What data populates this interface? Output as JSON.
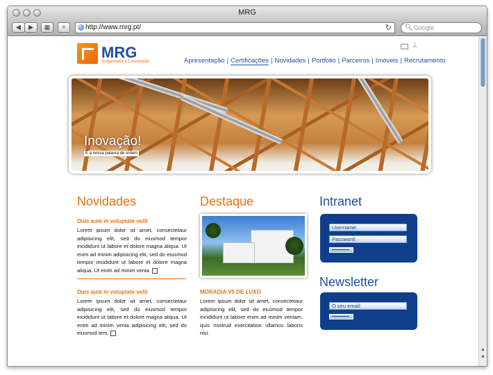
{
  "window": {
    "title": "MRG"
  },
  "toolbar": {
    "url": "http://www.mrg.pt/",
    "search_placeholder": "Google",
    "back_icon": "chevron-left-icon",
    "forward_icon": "chevron-right-icon"
  },
  "site": {
    "logo_name": "MRG",
    "logo_tagline": "Engenharia e Construção",
    "nav": [
      "Apresentação",
      "Certificações",
      "Novidades",
      "Portfolio",
      "Parceiros",
      "Imóveis",
      "Recrutamento"
    ],
    "active_nav": "Certificações",
    "colors": {
      "orange": "#e8720c",
      "blue": "#1e4f9c",
      "panel": "#0f3f8a"
    }
  },
  "banner": {
    "title": "Inovação!",
    "subtitle": "É a nossa palavra de ordem"
  },
  "novidades": {
    "heading": "Novidades",
    "items": [
      {
        "title": "Duis aute in voluptate velit",
        "text": "Lorem ipsum dolor sit amet, consectetaur adipisicing elit, sed do eiusmod tempor incididunt ut labore et dolore magna aliqua. Ut enim ad minim adipisicing elit, sed do eiusmod tempor incididunt ut labore et dolore magna aliqua. Ut enim ad minim venia."
      },
      {
        "title": "Duis aute in voluptate velit",
        "text": "Lorem ipsum dolor sit amet, consectetaur adipisicing elit, sed do eiusmod tempor incididunt ut labore et dolore magna aliqua. Ut enim ad minim venia adipisicing elit, sed do eiusmod tem."
      }
    ]
  },
  "destaque": {
    "heading": "Destaque",
    "title": "MORADIA V5 DE LUXO",
    "text": "Lorem ipsum dolor sit amet, consectetaur adipisicing elit, sed do eiusmod tempor incididunt ut labore enim ad minim veniam, quis nostrud exercitation ullamco laboris nisi."
  },
  "intranet": {
    "heading": "Intranet",
    "username_label": "Username:",
    "password_label": "Password:"
  },
  "newsletter": {
    "heading": "Newsletter",
    "email_label": "O seu email:"
  }
}
